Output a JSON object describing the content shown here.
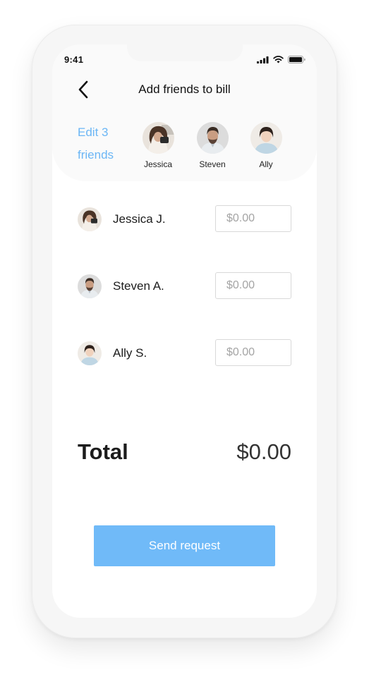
{
  "status_bar": {
    "time": "9:41"
  },
  "header": {
    "title": "Add friends to bill"
  },
  "selected_friends": {
    "edit_label": "Edit 3 friends",
    "items": [
      {
        "name": "Jessica"
      },
      {
        "name": "Steven"
      },
      {
        "name": "Ally"
      }
    ]
  },
  "split_rows": [
    {
      "name": "Jessica J.",
      "amount_placeholder": "$0.00"
    },
    {
      "name": "Steven A.",
      "amount_placeholder": "$0.00"
    },
    {
      "name": "Ally S.",
      "amount_placeholder": "$0.00"
    }
  ],
  "summary": {
    "total_label": "Total",
    "total_value": "$0.00"
  },
  "actions": {
    "send_label": "Send request"
  },
  "colors": {
    "accent": "#70baf8",
    "link": "#6bb6f5"
  }
}
